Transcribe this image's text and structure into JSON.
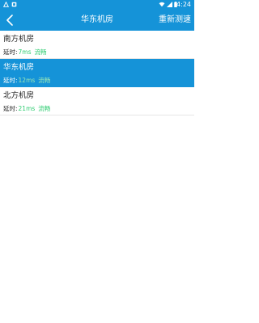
{
  "status_bar": {
    "time": "4:24",
    "left_icons": [
      "android-debug-icon",
      "notification-square-icon"
    ],
    "right_icons": [
      "wifi-icon",
      "signal-icon",
      "battery-icon"
    ]
  },
  "app_bar": {
    "title": "华东机房",
    "action_label": "重新测速",
    "back_icon": "chevron-left-icon"
  },
  "rooms": [
    {
      "name": "南方机房",
      "latency_label": "延时:",
      "latency_value": "7ms",
      "status": "流畅",
      "selected": false
    },
    {
      "name": "华东机房",
      "latency_label": "延时:",
      "latency_value": "12ms",
      "status": "流畅",
      "selected": true
    },
    {
      "name": "北方机房",
      "latency_label": "延时:",
      "latency_value": "21ms",
      "status": "流畅",
      "selected": false
    }
  ],
  "colors": {
    "primary": "#1593d8",
    "good_status": "#2ecc71",
    "text": "#222222",
    "divider": "#e6e6e6"
  }
}
